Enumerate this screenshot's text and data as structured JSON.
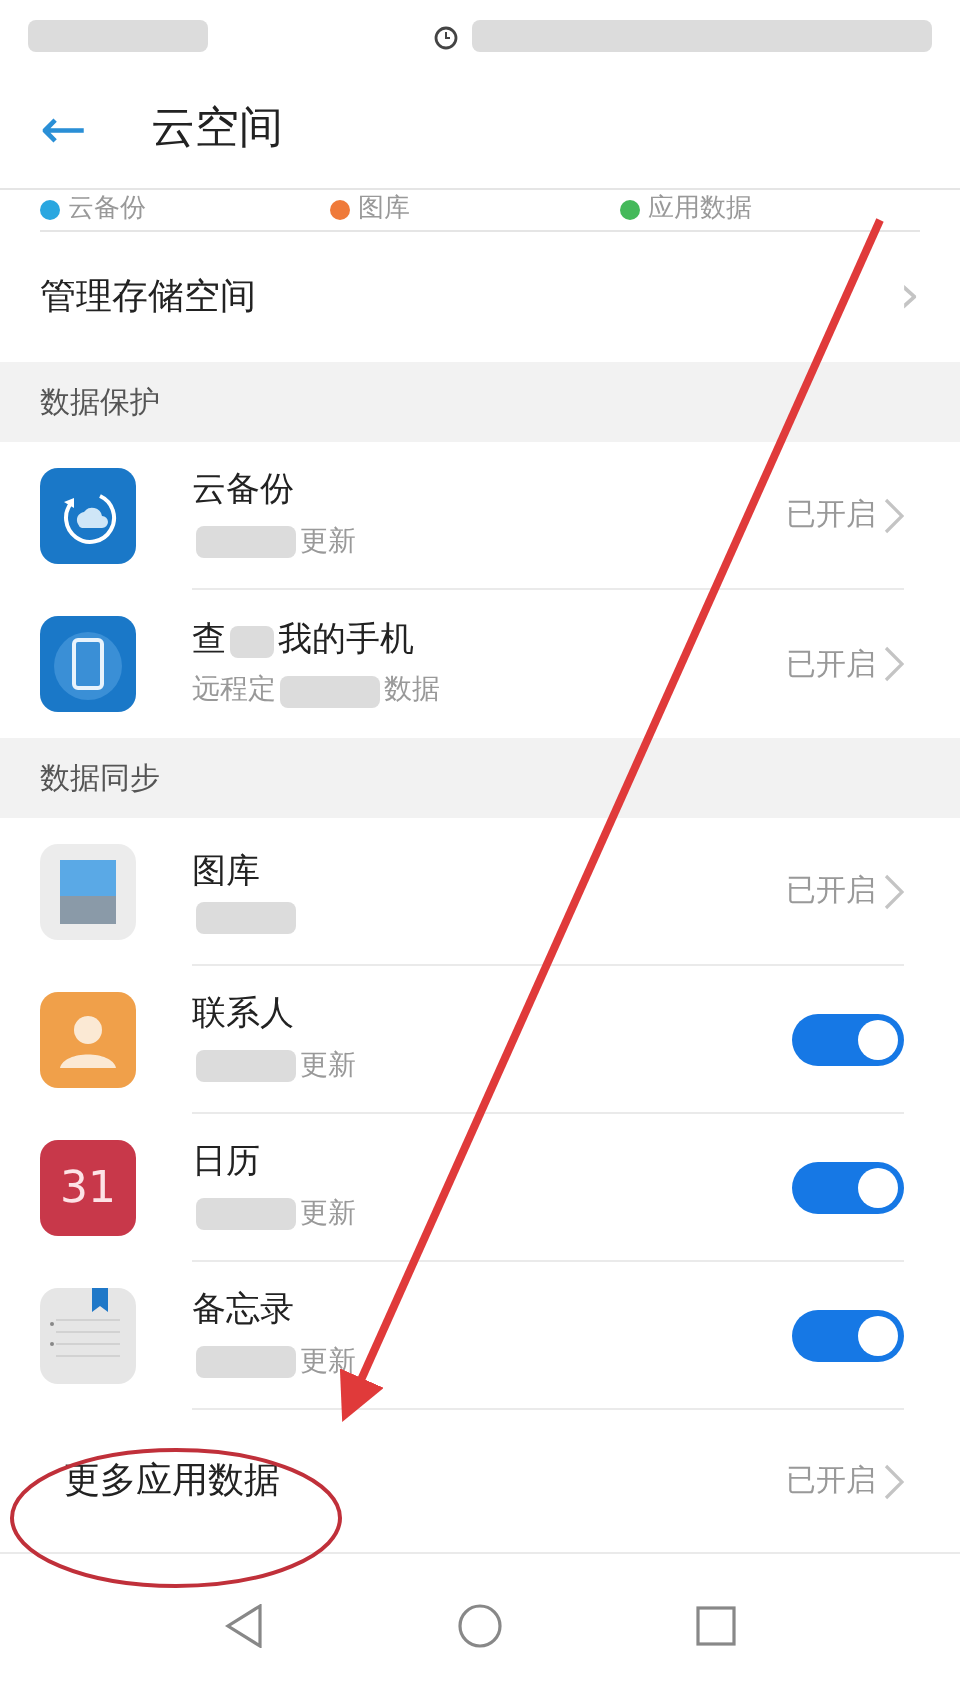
{
  "header": {
    "back": "←",
    "title": "云空间"
  },
  "legend": [
    {
      "label": "云备份",
      "color": "#2aa7e0"
    },
    {
      "label": "图库",
      "color": "#ef7a3a"
    },
    {
      "label": "应用数据",
      "color": "#44b95a"
    }
  ],
  "manage": {
    "label": "管理存储空间",
    "chevron": "›"
  },
  "sections": [
    {
      "title": "数据保护",
      "rows": [
        {
          "kind": "status",
          "title": [
            {
              "kind": "text",
              "text": "云备份"
            }
          ],
          "subtitle": [
            {
              "kind": "blur"
            },
            {
              "kind": "text",
              "text": "更新"
            }
          ],
          "status": "已开启"
        },
        {
          "kind": "status",
          "title": [
            {
              "kind": "text",
              "text": "查"
            },
            {
              "kind": "blur"
            },
            {
              "kind": "text",
              "text": "我的手机"
            }
          ],
          "subtitle": [
            {
              "kind": "text",
              "text": "远程定"
            },
            {
              "kind": "blur"
            },
            {
              "kind": "text",
              "text": "数据"
            }
          ],
          "status": "已开启"
        }
      ]
    },
    {
      "title": "数据同步",
      "rows": [
        {
          "kind": "status",
          "title": [
            {
              "kind": "text",
              "text": "图库"
            }
          ],
          "subtitle": [
            {
              "kind": "blur"
            }
          ],
          "status": "已开启"
        },
        {
          "kind": "toggle",
          "title": [
            {
              "kind": "text",
              "text": "联系人"
            }
          ],
          "subtitle": [
            {
              "kind": "blur"
            },
            {
              "kind": "text",
              "text": "更新"
            }
          ],
          "on": true
        },
        {
          "kind": "toggle",
          "title": [
            {
              "kind": "text",
              "text": "日历"
            }
          ],
          "subtitle": [
            {
              "kind": "blur"
            },
            {
              "kind": "text",
              "text": "更新"
            }
          ],
          "on": true,
          "icon_text": "31"
        },
        {
          "kind": "toggle",
          "title": [
            {
              "kind": "text",
              "text": "备忘录"
            }
          ],
          "subtitle": [
            {
              "kind": "blur"
            },
            {
              "kind": "text",
              "text": "更新"
            }
          ],
          "on": true
        }
      ]
    }
  ],
  "more": {
    "label": "更多应用数据",
    "status": "已开启"
  }
}
